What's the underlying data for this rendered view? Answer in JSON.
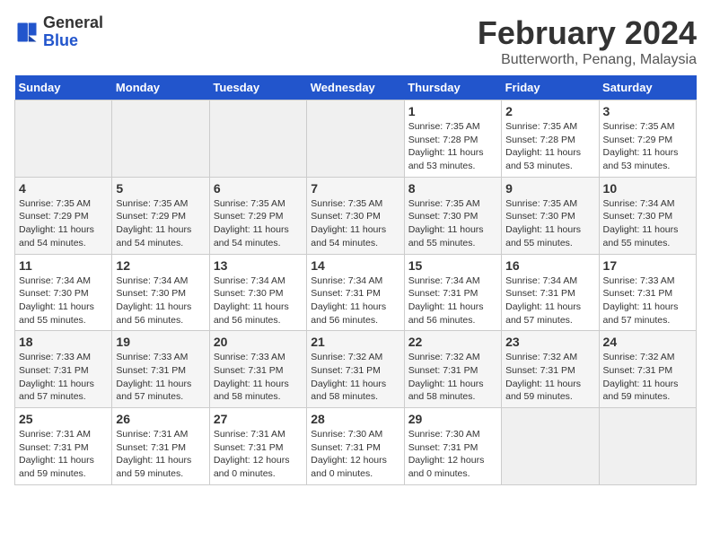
{
  "app": {
    "logo_general": "General",
    "logo_blue": "Blue"
  },
  "header": {
    "month_year": "February 2024",
    "location": "Butterworth, Penang, Malaysia"
  },
  "weekdays": [
    "Sunday",
    "Monday",
    "Tuesday",
    "Wednesday",
    "Thursday",
    "Friday",
    "Saturday"
  ],
  "weeks": [
    [
      {
        "num": "",
        "sunrise": "",
        "sunset": "",
        "daylight": ""
      },
      {
        "num": "",
        "sunrise": "",
        "sunset": "",
        "daylight": ""
      },
      {
        "num": "",
        "sunrise": "",
        "sunset": "",
        "daylight": ""
      },
      {
        "num": "",
        "sunrise": "",
        "sunset": "",
        "daylight": ""
      },
      {
        "num": "1",
        "sunrise": "Sunrise: 7:35 AM",
        "sunset": "Sunset: 7:28 PM",
        "daylight": "Daylight: 11 hours and 53 minutes."
      },
      {
        "num": "2",
        "sunrise": "Sunrise: 7:35 AM",
        "sunset": "Sunset: 7:28 PM",
        "daylight": "Daylight: 11 hours and 53 minutes."
      },
      {
        "num": "3",
        "sunrise": "Sunrise: 7:35 AM",
        "sunset": "Sunset: 7:29 PM",
        "daylight": "Daylight: 11 hours and 53 minutes."
      }
    ],
    [
      {
        "num": "4",
        "sunrise": "Sunrise: 7:35 AM",
        "sunset": "Sunset: 7:29 PM",
        "daylight": "Daylight: 11 hours and 54 minutes."
      },
      {
        "num": "5",
        "sunrise": "Sunrise: 7:35 AM",
        "sunset": "Sunset: 7:29 PM",
        "daylight": "Daylight: 11 hours and 54 minutes."
      },
      {
        "num": "6",
        "sunrise": "Sunrise: 7:35 AM",
        "sunset": "Sunset: 7:29 PM",
        "daylight": "Daylight: 11 hours and 54 minutes."
      },
      {
        "num": "7",
        "sunrise": "Sunrise: 7:35 AM",
        "sunset": "Sunset: 7:30 PM",
        "daylight": "Daylight: 11 hours and 54 minutes."
      },
      {
        "num": "8",
        "sunrise": "Sunrise: 7:35 AM",
        "sunset": "Sunset: 7:30 PM",
        "daylight": "Daylight: 11 hours and 55 minutes."
      },
      {
        "num": "9",
        "sunrise": "Sunrise: 7:35 AM",
        "sunset": "Sunset: 7:30 PM",
        "daylight": "Daylight: 11 hours and 55 minutes."
      },
      {
        "num": "10",
        "sunrise": "Sunrise: 7:34 AM",
        "sunset": "Sunset: 7:30 PM",
        "daylight": "Daylight: 11 hours and 55 minutes."
      }
    ],
    [
      {
        "num": "11",
        "sunrise": "Sunrise: 7:34 AM",
        "sunset": "Sunset: 7:30 PM",
        "daylight": "Daylight: 11 hours and 55 minutes."
      },
      {
        "num": "12",
        "sunrise": "Sunrise: 7:34 AM",
        "sunset": "Sunset: 7:30 PM",
        "daylight": "Daylight: 11 hours and 56 minutes."
      },
      {
        "num": "13",
        "sunrise": "Sunrise: 7:34 AM",
        "sunset": "Sunset: 7:30 PM",
        "daylight": "Daylight: 11 hours and 56 minutes."
      },
      {
        "num": "14",
        "sunrise": "Sunrise: 7:34 AM",
        "sunset": "Sunset: 7:31 PM",
        "daylight": "Daylight: 11 hours and 56 minutes."
      },
      {
        "num": "15",
        "sunrise": "Sunrise: 7:34 AM",
        "sunset": "Sunset: 7:31 PM",
        "daylight": "Daylight: 11 hours and 56 minutes."
      },
      {
        "num": "16",
        "sunrise": "Sunrise: 7:34 AM",
        "sunset": "Sunset: 7:31 PM",
        "daylight": "Daylight: 11 hours and 57 minutes."
      },
      {
        "num": "17",
        "sunrise": "Sunrise: 7:33 AM",
        "sunset": "Sunset: 7:31 PM",
        "daylight": "Daylight: 11 hours and 57 minutes."
      }
    ],
    [
      {
        "num": "18",
        "sunrise": "Sunrise: 7:33 AM",
        "sunset": "Sunset: 7:31 PM",
        "daylight": "Daylight: 11 hours and 57 minutes."
      },
      {
        "num": "19",
        "sunrise": "Sunrise: 7:33 AM",
        "sunset": "Sunset: 7:31 PM",
        "daylight": "Daylight: 11 hours and 57 minutes."
      },
      {
        "num": "20",
        "sunrise": "Sunrise: 7:33 AM",
        "sunset": "Sunset: 7:31 PM",
        "daylight": "Daylight: 11 hours and 58 minutes."
      },
      {
        "num": "21",
        "sunrise": "Sunrise: 7:32 AM",
        "sunset": "Sunset: 7:31 PM",
        "daylight": "Daylight: 11 hours and 58 minutes."
      },
      {
        "num": "22",
        "sunrise": "Sunrise: 7:32 AM",
        "sunset": "Sunset: 7:31 PM",
        "daylight": "Daylight: 11 hours and 58 minutes."
      },
      {
        "num": "23",
        "sunrise": "Sunrise: 7:32 AM",
        "sunset": "Sunset: 7:31 PM",
        "daylight": "Daylight: 11 hours and 59 minutes."
      },
      {
        "num": "24",
        "sunrise": "Sunrise: 7:32 AM",
        "sunset": "Sunset: 7:31 PM",
        "daylight": "Daylight: 11 hours and 59 minutes."
      }
    ],
    [
      {
        "num": "25",
        "sunrise": "Sunrise: 7:31 AM",
        "sunset": "Sunset: 7:31 PM",
        "daylight": "Daylight: 11 hours and 59 minutes."
      },
      {
        "num": "26",
        "sunrise": "Sunrise: 7:31 AM",
        "sunset": "Sunset: 7:31 PM",
        "daylight": "Daylight: 11 hours and 59 minutes."
      },
      {
        "num": "27",
        "sunrise": "Sunrise: 7:31 AM",
        "sunset": "Sunset: 7:31 PM",
        "daylight": "Daylight: 12 hours and 0 minutes."
      },
      {
        "num": "28",
        "sunrise": "Sunrise: 7:30 AM",
        "sunset": "Sunset: 7:31 PM",
        "daylight": "Daylight: 12 hours and 0 minutes."
      },
      {
        "num": "29",
        "sunrise": "Sunrise: 7:30 AM",
        "sunset": "Sunset: 7:31 PM",
        "daylight": "Daylight: 12 hours and 0 minutes."
      },
      {
        "num": "",
        "sunrise": "",
        "sunset": "",
        "daylight": ""
      },
      {
        "num": "",
        "sunrise": "",
        "sunset": "",
        "daylight": ""
      }
    ]
  ]
}
